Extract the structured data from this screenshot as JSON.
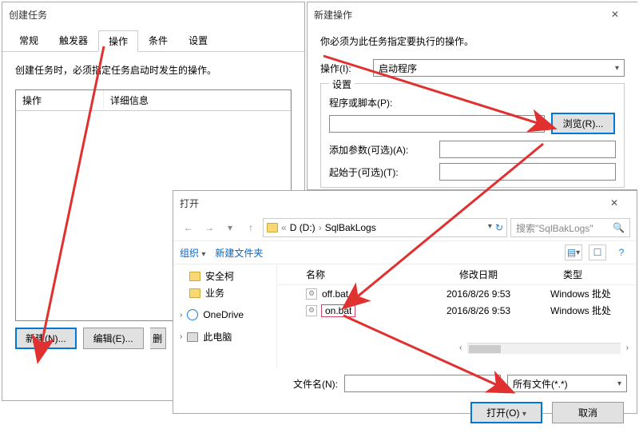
{
  "createTask": {
    "title": "创建任务",
    "tabs": {
      "general": "常规",
      "triggers": "触发器",
      "actions": "操作",
      "conditions": "条件",
      "settings": "设置"
    },
    "desc": "创建任务时，必须指定任务启动时发生的操作。",
    "cols": {
      "action": "操作",
      "detail": "详细信息"
    },
    "buttons": {
      "new": "新建(N)...",
      "edit": "编辑(E)...",
      "del": "删"
    }
  },
  "newAction": {
    "title": "新建操作",
    "desc": "你必须为此任务指定要执行的操作。",
    "actionLabel": "操作(I):",
    "actionValue": "启动程序",
    "settingsLegend": "设置",
    "progLabel": "程序或脚本(P):",
    "browse": "浏览(R)...",
    "argsLabel": "添加参数(可选)(A):",
    "startInLabel": "起始于(可选)(T):"
  },
  "openDialog": {
    "title": "打开",
    "path": {
      "drive": "D (D:)",
      "folder": "SqlBakLogs"
    },
    "searchPlaceholder": "搜索\"SqlBakLogs\"",
    "org": "组织",
    "newFolder": "新建文件夹",
    "tree": {
      "item1": "安全柯",
      "item2": "业务",
      "item3": "OneDrive",
      "item4": "此电脑"
    },
    "cols": {
      "name": "名称",
      "date": "修改日期",
      "type": "类型"
    },
    "files": [
      {
        "name": "off.bat",
        "date": "2016/8/26 9:53",
        "type": "Windows 批处"
      },
      {
        "name": "on.bat",
        "date": "2016/8/26 9:53",
        "type": "Windows 批处"
      }
    ],
    "filenameLabel": "文件名(N):",
    "filter": "所有文件(*.*)",
    "open": "打开(O)",
    "cancel": "取消"
  }
}
